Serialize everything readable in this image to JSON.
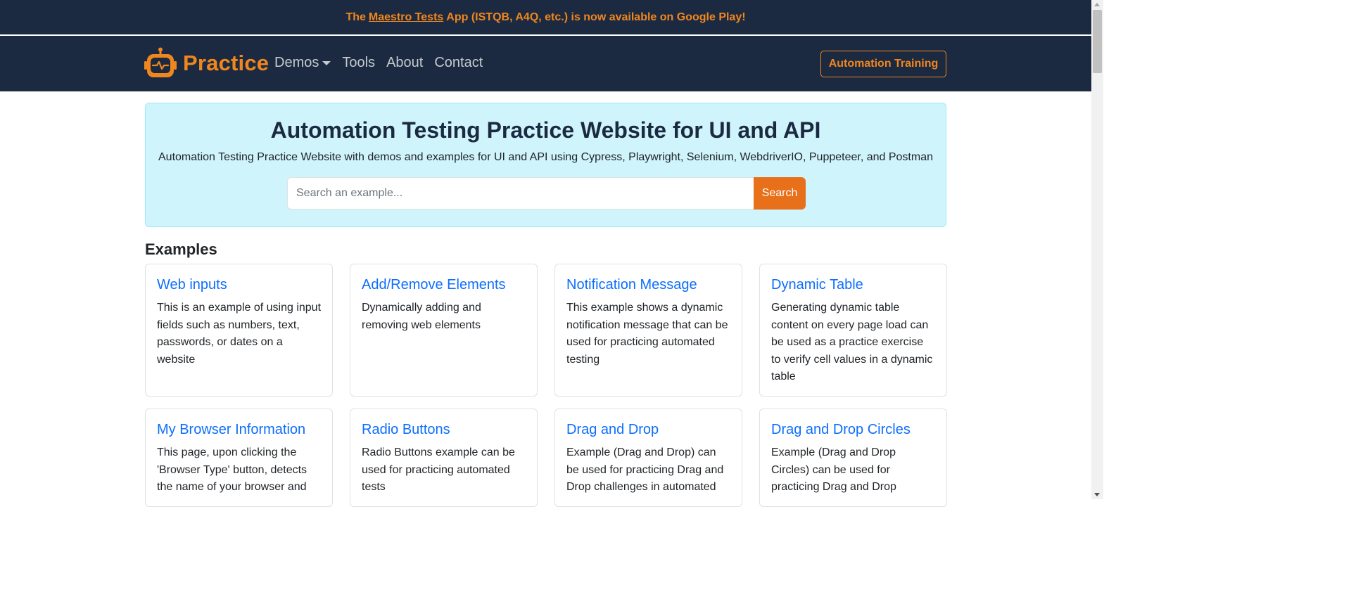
{
  "announcement": {
    "prefix": "The",
    "link": "Maestro Tests",
    "suffix": "App (ISTQB, A4Q, etc.) is now available on Google Play!"
  },
  "navbar": {
    "brand": "Practice",
    "links": [
      "Demos",
      "Tools",
      "About",
      "Contact"
    ],
    "cta": "Automation Training"
  },
  "hero": {
    "title": "Automation Testing Practice Website for UI and API",
    "subtitle": "Automation Testing Practice Website with demos and examples for UI and API using Cypress, Playwright, Selenium, WebdriverIO, Puppeteer, and Postman",
    "search_placeholder": "Search an example...",
    "search_button": "Search"
  },
  "examples": {
    "heading": "Examples",
    "cards": [
      {
        "title": "Web inputs",
        "text": "This is an example of using input fields such as numbers, text, passwords, or dates on a website"
      },
      {
        "title": "Add/Remove Elements",
        "text": "Dynamically adding and removing web elements"
      },
      {
        "title": "Notification Message",
        "text": "This example shows a dynamic notification message that can be used for practicing automated testing"
      },
      {
        "title": "Dynamic Table",
        "text": "Generating dynamic table content on every page load can be used as a practice exercise to verify cell values in a dynamic table"
      },
      {
        "title": "My Browser Information",
        "text": "This page, upon clicking the 'Browser Type' button, detects the name of your browser and"
      },
      {
        "title": "Radio Buttons",
        "text": "Radio Buttons example can be used for practicing automated tests"
      },
      {
        "title": "Drag and Drop",
        "text": "Example (Drag and Drop) can be used for practicing Drag and Drop challenges in automated"
      },
      {
        "title": "Drag and Drop Circles",
        "text": "Example (Drag and Drop Circles) can be used for practicing Drag and Drop"
      }
    ]
  },
  "colors": {
    "navy": "#1b2a41",
    "orange": "#f0861e",
    "hero_bg": "#cff4fc",
    "link_blue": "#0d6efd"
  },
  "icons": {
    "brand_logo": "robot-icon",
    "demos_dropdown": "caret-down-icon"
  }
}
